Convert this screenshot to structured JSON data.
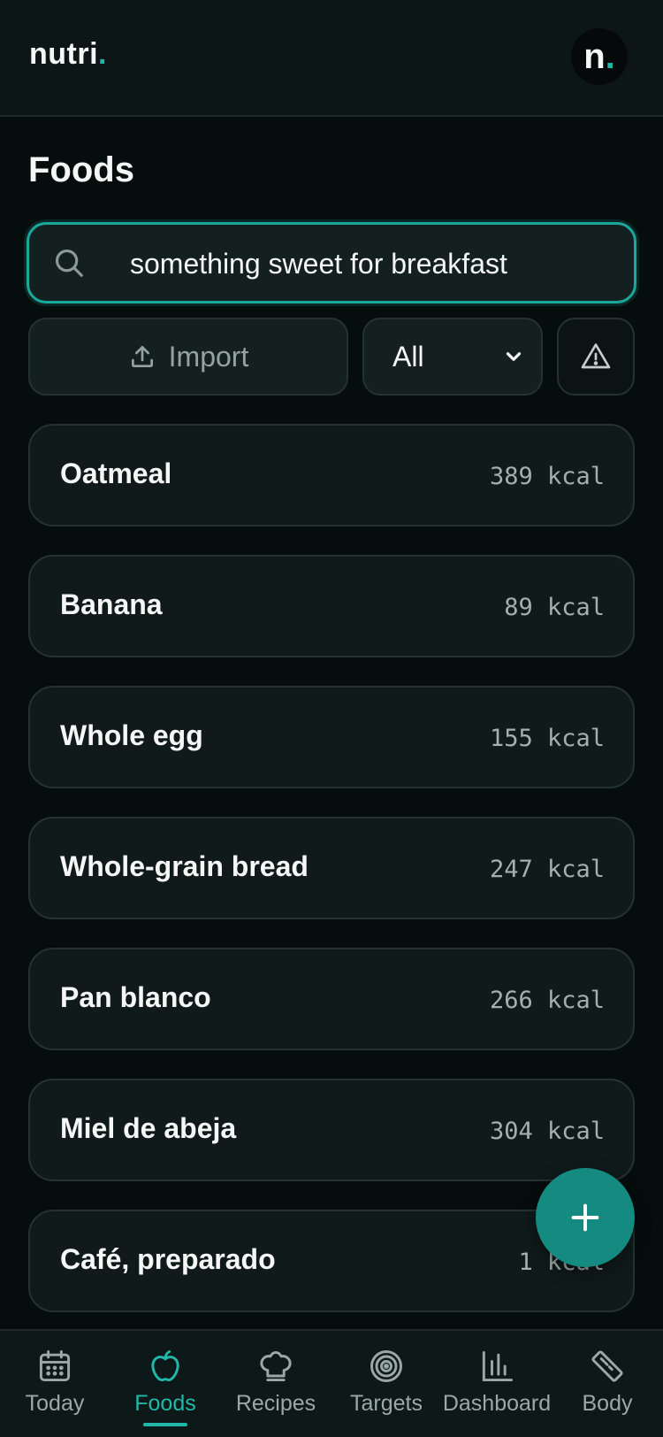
{
  "header": {
    "brand": "nutri",
    "brand_dot": ".",
    "avatar_letter": "n",
    "avatar_dot": "."
  },
  "page_title": "Foods",
  "search": {
    "value": "something sweet for breakfast",
    "icon": "search-icon"
  },
  "toolbar": {
    "import_label": "Import",
    "import_icon": "upload-icon",
    "filter_value": "All",
    "warning_icon": "warning-triangle-icon"
  },
  "foods": [
    {
      "name": "Oatmeal",
      "kcal": "389 kcal"
    },
    {
      "name": "Banana",
      "kcal": "89 kcal"
    },
    {
      "name": "Whole egg",
      "kcal": "155 kcal"
    },
    {
      "name": "Whole-grain bread",
      "kcal": "247 kcal"
    },
    {
      "name": "Pan blanco",
      "kcal": "266 kcal"
    },
    {
      "name": "Miel de abeja",
      "kcal": "304 kcal"
    },
    {
      "name": "Café, preparado",
      "kcal": "1 kcal"
    }
  ],
  "fab": {
    "icon": "plus-icon"
  },
  "nav": {
    "items": [
      {
        "label": "Today",
        "icon": "calendar-icon"
      },
      {
        "label": "Foods",
        "icon": "apple-icon",
        "active": true
      },
      {
        "label": "Recipes",
        "icon": "chef-hat-icon"
      },
      {
        "label": "Targets",
        "icon": "target-icon"
      },
      {
        "label": "Dashboard",
        "icon": "bar-chart-icon"
      },
      {
        "label": "Body",
        "icon": "ruler-icon"
      }
    ]
  },
  "colors": {
    "accent": "#1fb5a7",
    "background": "#060d0d",
    "card": "#101a1a",
    "fab": "#148a80"
  }
}
